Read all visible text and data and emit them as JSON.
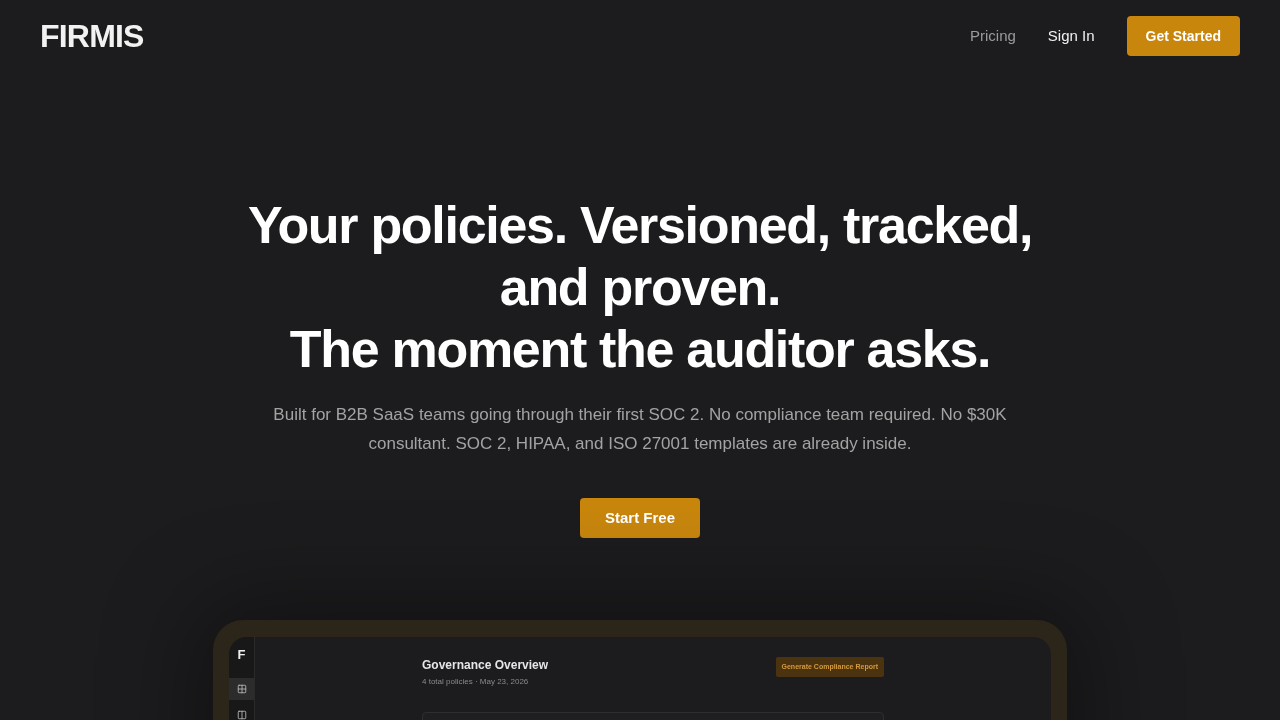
{
  "nav": {
    "logo": "FIRMIS",
    "items": [
      {
        "kind": "link",
        "label": "Pricing"
      },
      {
        "kind": "text",
        "label": "Sign In"
      },
      {
        "kind": "primary",
        "label": "Get Started"
      }
    ]
  },
  "hero": {
    "headline": [
      "Your policies. Versioned, tracked, and proven.",
      "The moment the auditor asks."
    ],
    "subtitle": "Built for B2B SaaS teams going through their first SOC 2. No compliance team required. No $30K consultant. SOC 2, HIPAA, and ISO 27001 templates are already inside.",
    "cta": "Start Free"
  },
  "preview": {
    "sidebar": {
      "logo": "F",
      "items": [
        {
          "kind": "grid",
          "selected": true
        },
        {
          "kind": "columns",
          "selected": false
        }
      ]
    },
    "title": "Governance Overview",
    "meta": "4 total policies · May 23, 2026",
    "action": "Generate Compliance Report"
  }
}
